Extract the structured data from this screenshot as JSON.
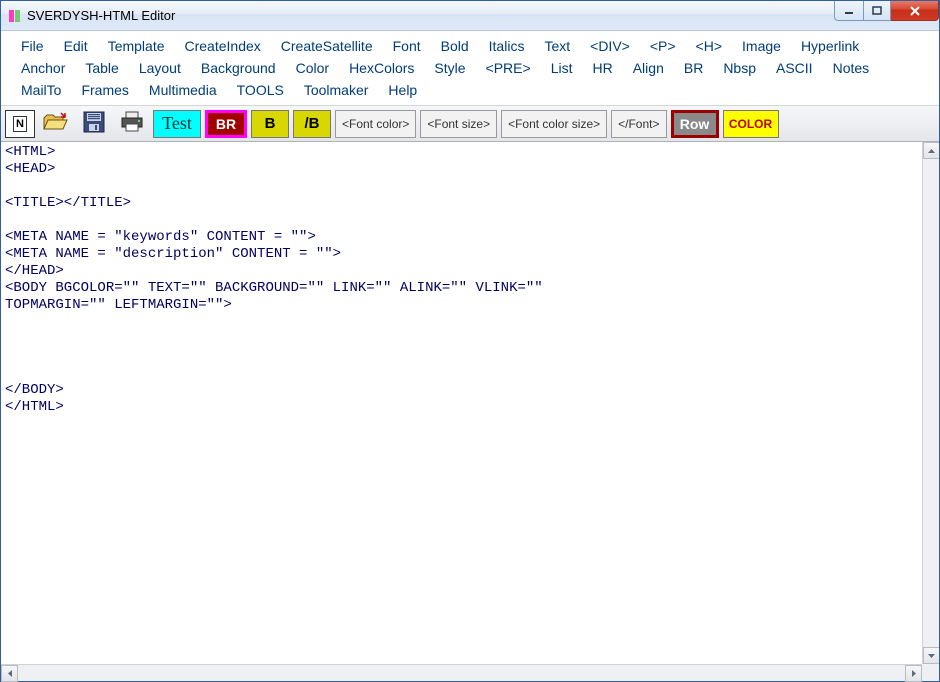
{
  "window": {
    "title": "SVERDYSH-HTML Editor"
  },
  "menu": {
    "items": [
      "File",
      "Edit",
      "Template",
      "CreateIndex",
      "CreateSatellite",
      "Font",
      "Bold",
      "Italics",
      "Text",
      "<DIV>",
      "<P>",
      "<H>",
      "Image",
      "Hyperlink",
      "Anchor",
      "Table",
      "Layout",
      "Background",
      "Color",
      "HexColors",
      "Style",
      "<PRE>",
      "List",
      "HR",
      "Align",
      "BR",
      "Nbsp",
      "ASCII",
      "Notes",
      "MailTo",
      "Frames",
      "Multimedia",
      "TOOLS",
      "Toolmaker",
      "Help"
    ]
  },
  "toolbar": {
    "new_label": "N",
    "test_label": "Test",
    "br_label": "BR",
    "b_label": "B",
    "b_close_label": "/B",
    "font_color_label": "<Font color>",
    "font_size_label": "<Font size>",
    "font_color_size_label": "<Font color size>",
    "font_close_label": "</Font>",
    "row_label": "Row",
    "color_label": "COLOR"
  },
  "editor": {
    "content": "<HTML>\n<HEAD>\n\n<TITLE></TITLE>\n\n<META NAME = \"keywords\" CONTENT = \"\">\n<META NAME = \"description\" CONTENT = \"\">\n</HEAD>\n<BODY BGCOLOR=\"\" TEXT=\"\" BACKGROUND=\"\" LINK=\"\" ALINK=\"\" VLINK=\"\"\nTOPMARGIN=\"\" LEFTMARGIN=\"\">\n\n\n\n\n</BODY>\n</HTML>\n"
  }
}
